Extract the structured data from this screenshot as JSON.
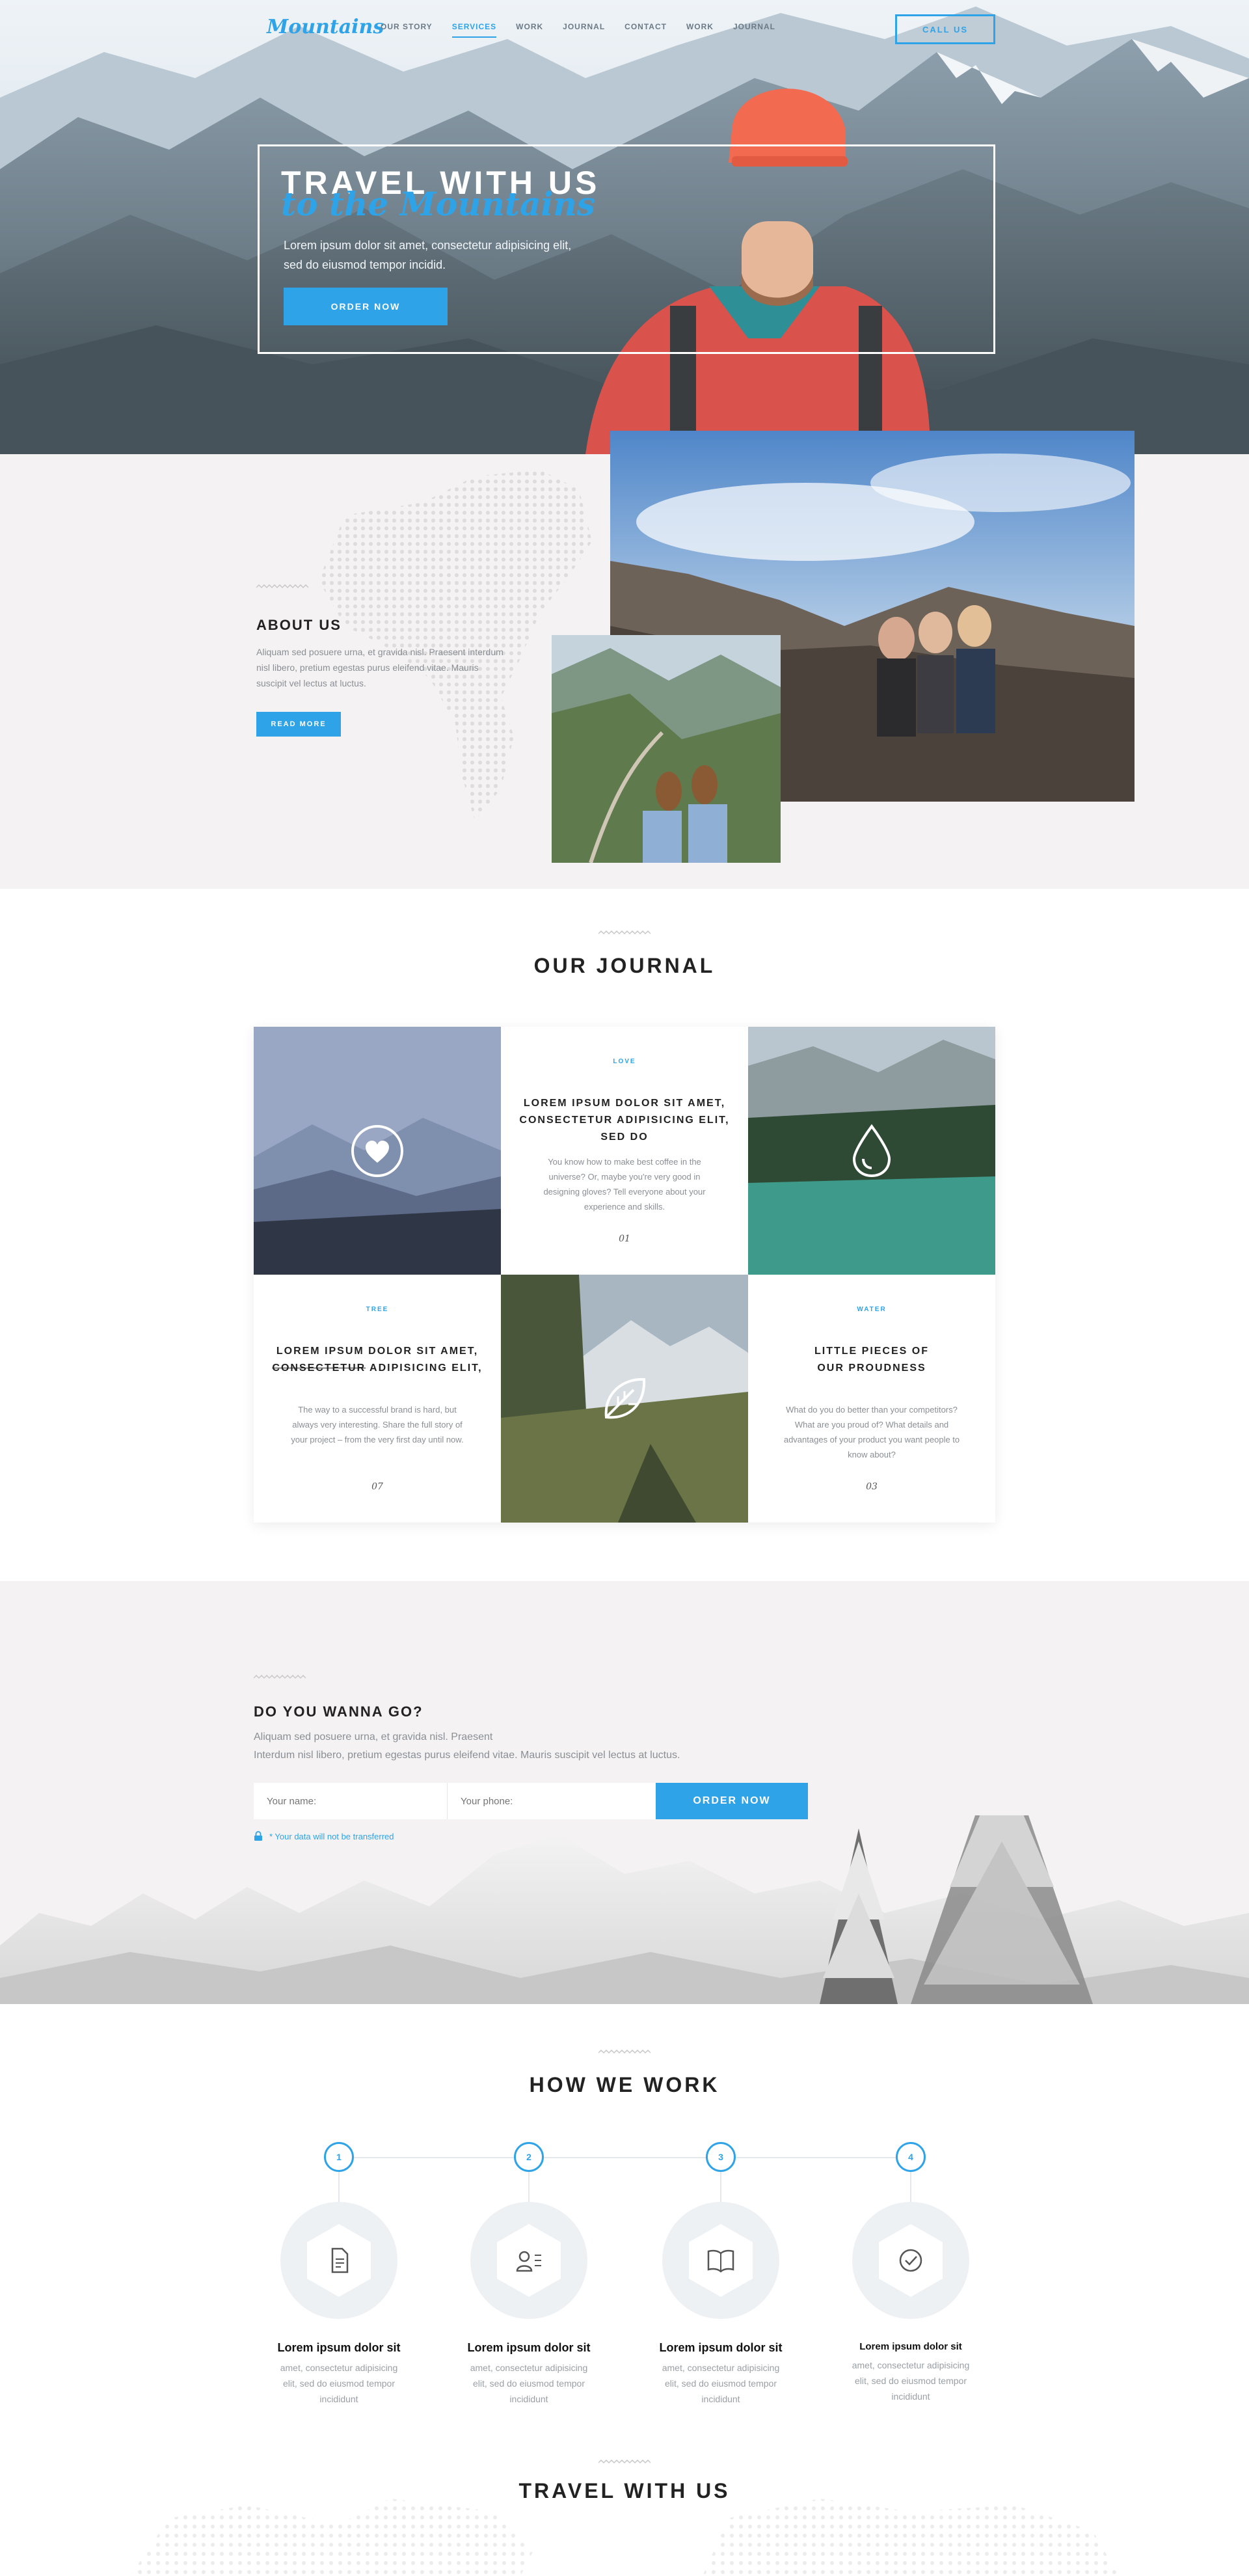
{
  "brand": {
    "logo": "Mountains",
    "accent_color": "#2ea3e8"
  },
  "nav": {
    "items": [
      {
        "label": "OUR STORY",
        "active": false
      },
      {
        "label": "SERVICES",
        "active": true
      },
      {
        "label": "WORK",
        "active": false
      },
      {
        "label": "JOURNAL",
        "active": false
      },
      {
        "label": "CONTACT",
        "active": false
      },
      {
        "label": "WORK",
        "active": false
      },
      {
        "label": "JOURNAL",
        "active": false
      }
    ],
    "call_button": "CALL US"
  },
  "hero": {
    "title_line1": "TRAVEL WITH US",
    "title_line2": "to the Mountains",
    "text": "Lorem ipsum dolor sit amet, consectetur adipisicing elit, sed do eiusmod tempor incidid.",
    "button": "ORDER NOW"
  },
  "about": {
    "title": "ABOUT US",
    "text": "Aliquam sed posuere urna, et gravida nisl. Praesent interdum nisl libero, pretium egestas purus eleifend vitae. Mauris suscipit vel lectus at luctus.",
    "button": "READ MORE"
  },
  "journal": {
    "title": "OUR JOURNAL",
    "cards": [
      {
        "tag": "LOVE",
        "title": "LOREM IPSUM DOLOR SIT AMET, CONSECTETUR ADIPISICING ELIT, SED DO",
        "text": "You know how to make best coffee in the universe? Or, maybe you're very good in designing gloves? Tell everyone about your experience and skills.",
        "num": "01"
      },
      {
        "tag": "TREE",
        "title_a": "LOREM IPSUM DOLOR SIT AMET, ",
        "title_strike": "CONSECTETUR",
        "title_b": " ADIPISICING ELIT,",
        "text": "The way to a successful brand is hard, but always very interesting. Share the full story of your project – from the very first day until now.",
        "num": "07"
      },
      {
        "tag": "WATER",
        "title": "LITTLE PIECES OF OUR PROUDNESS",
        "text": "What do you do better than your competitors? What are you proud of? What details and advantages of your product you want people to know about?",
        "num": "03"
      }
    ],
    "image_icons": [
      "heart-icon",
      "drop-icon",
      "leaf-icon"
    ]
  },
  "go": {
    "title": "DO YOU WANNA GO?",
    "text_line1": "Aliquam sed posuere urna, et gravida nisl. Praesent",
    "text_line2": "Interdum nisl libero, pretium egestas purus eleifend vitae. Mauris suscipit vel lectus at luctus.",
    "name_placeholder": "Your name:",
    "phone_placeholder": "Your phone:",
    "button": "ORDER NOW",
    "note": "* Your data will not be transferred"
  },
  "how": {
    "title": "HOW WE WORK",
    "steps": [
      {
        "num": "1",
        "icon": "document-icon",
        "title": "Lorem ipsum dolor sit",
        "text": "amet, consectetur adipisicing elit, sed do eiusmod tempor incididunt"
      },
      {
        "num": "2",
        "icon": "contact-list-icon",
        "title": "Lorem ipsum dolor sit",
        "text": "amet, consectetur adipisicing elit, sed do eiusmod tempor incididunt"
      },
      {
        "num": "3",
        "icon": "book-icon",
        "title": "Lorem ipsum dolor sit",
        "text": "amet, consectetur adipisicing elit, sed do eiusmod tempor incididunt"
      },
      {
        "num": "4",
        "icon": "check-circle-icon",
        "title": "Lorem ipsum dolor sit",
        "text": "amet, consectetur adipisicing elit, sed do eiusmod tempor incididunt"
      }
    ]
  },
  "travel": {
    "title": "TRAVEL WITH US"
  }
}
